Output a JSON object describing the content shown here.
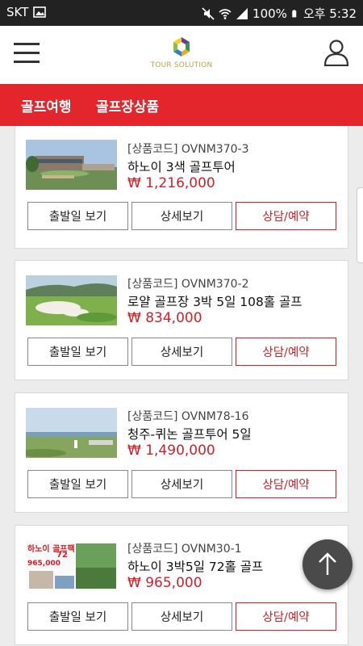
{
  "status_bar": {
    "carrier": "SKT",
    "battery": "100%",
    "time": "오후 5:32"
  },
  "header": {
    "logo_text": "TOUR SOLUTION",
    "menu_icon": "hamburger-menu-icon",
    "user_icon": "user-icon"
  },
  "categories": [
    {
      "label": "골프여행"
    },
    {
      "label": "골프장상품"
    }
  ],
  "products": [
    {
      "code": "[상품코드] OVNM370-3",
      "title": "하노이 3색 골프투어",
      "price": "₩ 1,216,000",
      "btn_departure": "출발일 보기",
      "btn_detail": "상세보기",
      "btn_consult": "상담/예약"
    },
    {
      "code": "[상품코드] OVNM370-2",
      "title": "로얄 골프장 3박 5일 108홀 골프",
      "price": "₩ 834,000",
      "btn_departure": "출발일 보기",
      "btn_detail": "상세보기",
      "btn_consult": "상담/예약"
    },
    {
      "code": "[상품코드] OVNM78-16",
      "title": "청주-퀴논 골프투어 5일",
      "price": "₩ 1,490,000",
      "btn_departure": "출발일 보기",
      "btn_detail": "상세보기",
      "btn_consult": "상담/예약"
    },
    {
      "code": "[상품코드] OVNM30-1",
      "title": "하노이 3박5일 72홀 골프",
      "price": "₩ 965,000",
      "btn_departure": "출발일 보기",
      "btn_detail": "상세보기",
      "btn_consult": "상담/예약",
      "thumb_text": "하노이 골프팩",
      "thumb_num": "72",
      "thumb_price": "965,000"
    }
  ],
  "colors": {
    "accent": "#e3262b",
    "price": "#d0202a"
  }
}
